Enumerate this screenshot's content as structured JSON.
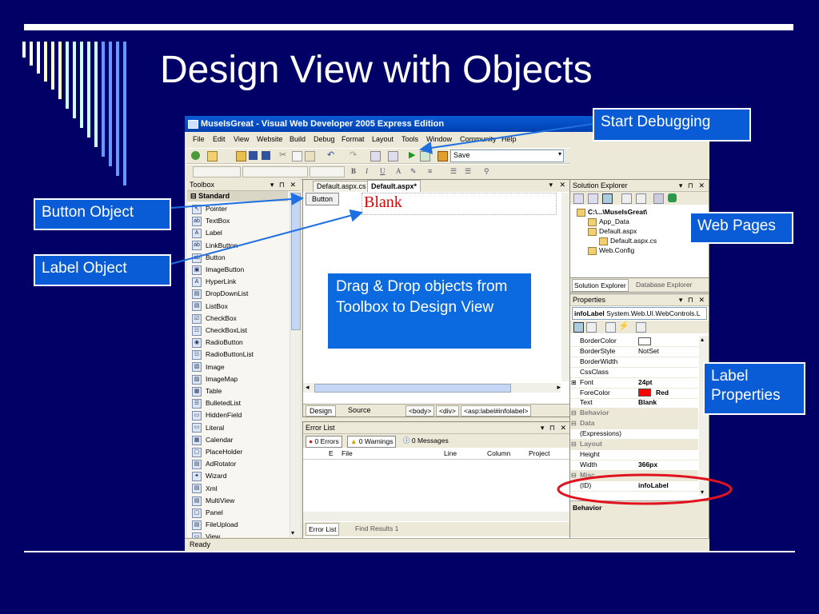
{
  "slide": {
    "title": "Design View with Objects"
  },
  "callouts": {
    "start_debugging": "Start Debugging",
    "button_object": "Button Object",
    "label_object": "Label Object",
    "web_pages": "Web Pages",
    "label_properties": "Label Properties",
    "drag_drop": "Drag & Drop objects from Toolbox to Design View"
  },
  "window": {
    "title": "MuseIsGreat - Visual Web Developer 2005 Express Edition",
    "menu": [
      "File",
      "Edit",
      "View",
      "Website",
      "Build",
      "Debug",
      "Format",
      "Layout",
      "Tools",
      "Window",
      "Community",
      "Help"
    ],
    "toolbar": {
      "save_label": "Save"
    },
    "status": "Ready"
  },
  "toolbox": {
    "title": "Toolbox",
    "pin": "▾ ⊓ ✕",
    "group": "Standard",
    "items": [
      {
        "label": "Pointer",
        "icon": "pointer-icon"
      },
      {
        "label": "TextBox",
        "icon": "textbox-icon"
      },
      {
        "label": "Label",
        "icon": "label-icon"
      },
      {
        "label": "LinkButton",
        "icon": "linkbutton-icon"
      },
      {
        "label": "Button",
        "icon": "button-icon"
      },
      {
        "label": "ImageButton",
        "icon": "imagebutton-icon"
      },
      {
        "label": "HyperLink",
        "icon": "hyperlink-icon"
      },
      {
        "label": "DropDownList",
        "icon": "dropdownlist-icon"
      },
      {
        "label": "ListBox",
        "icon": "listbox-icon"
      },
      {
        "label": "CheckBox",
        "icon": "checkbox-icon"
      },
      {
        "label": "CheckBoxList",
        "icon": "checkboxlist-icon"
      },
      {
        "label": "RadioButton",
        "icon": "radiobutton-icon"
      },
      {
        "label": "RadioButtonList",
        "icon": "radiobuttonlist-icon"
      },
      {
        "label": "Image",
        "icon": "image-icon"
      },
      {
        "label": "ImageMap",
        "icon": "imagemap-icon"
      },
      {
        "label": "Table",
        "icon": "table-icon"
      },
      {
        "label": "BulletedList",
        "icon": "bulletedlist-icon"
      },
      {
        "label": "HiddenField",
        "icon": "hiddenfield-icon"
      },
      {
        "label": "Literal",
        "icon": "literal-icon"
      },
      {
        "label": "Calendar",
        "icon": "calendar-icon"
      },
      {
        "label": "PlaceHolder",
        "icon": "placeholder-icon"
      },
      {
        "label": "AdRotator",
        "icon": "adrotator-icon"
      },
      {
        "label": "Wizard",
        "icon": "wizard-icon"
      },
      {
        "label": "Xml",
        "icon": "xml-icon"
      },
      {
        "label": "MultiView",
        "icon": "multiview-icon"
      },
      {
        "label": "Panel",
        "icon": "panel-icon"
      },
      {
        "label": "FileUpload",
        "icon": "fileupload-icon"
      },
      {
        "label": "View",
        "icon": "view-icon"
      }
    ]
  },
  "editor": {
    "tabs": [
      {
        "label": "Default.aspx.cs",
        "active": false
      },
      {
        "label": "Default.aspx*",
        "active": true
      }
    ],
    "button_text": "Button",
    "label_text": "Blank",
    "mode_tabs": [
      "Design",
      "Source"
    ],
    "breadcrumbs": [
      "<body>",
      "<div>",
      "<asp:label#infolabel>"
    ]
  },
  "error_list": {
    "title": "Error List",
    "filters": [
      "0 Errors",
      "0 Warnings",
      "0 Messages"
    ],
    "columns": [
      "",
      "File",
      "Line",
      "Column",
      "Project"
    ],
    "bottom_tabs": [
      "Error List",
      "Find Results 1"
    ]
  },
  "solution_explorer": {
    "title": "Solution Explorer",
    "tree": [
      {
        "label": "C:\\...\\MuseIsGreat\\",
        "level": 0,
        "bold": true
      },
      {
        "label": "App_Data",
        "level": 1
      },
      {
        "label": "Default.aspx",
        "level": 1
      },
      {
        "label": "Default.aspx.cs",
        "level": 2
      },
      {
        "label": "Web.Config",
        "level": 1
      }
    ],
    "tabs": [
      "Solution Explorer",
      "Database Explorer"
    ]
  },
  "properties": {
    "title": "Properties",
    "object_name": "infoLabel",
    "object_type": "System.Web.UI.WebControls.L",
    "rows": [
      {
        "k": "BorderColor",
        "v": "",
        "swatch": "#ffffff"
      },
      {
        "k": "BorderStyle",
        "v": "NotSet"
      },
      {
        "k": "BorderWidth",
        "v": ""
      },
      {
        "k": "CssClass",
        "v": ""
      },
      {
        "k": "Font",
        "v": "24pt",
        "bold": true,
        "expand": true
      },
      {
        "k": "ForeColor",
        "v": "Red",
        "bold": true,
        "swatch": "#ff0000"
      },
      {
        "k": "Text",
        "v": "Blank",
        "bold": true
      },
      {
        "k": "Behavior",
        "cat": true
      },
      {
        "k": "Data",
        "cat": true
      },
      {
        "k": "(Expressions)",
        "v": ""
      },
      {
        "k": "Layout",
        "cat": true
      },
      {
        "k": "Height",
        "v": ""
      },
      {
        "k": "Width",
        "v": "366px",
        "bold": true
      },
      {
        "k": "Misc",
        "cat": true
      },
      {
        "k": "(ID)",
        "v": "infoLabel",
        "bold": true
      }
    ],
    "footer": "Behavior"
  },
  "colors": {
    "slide_bg": "#000066",
    "callout_bg": "#0a5cd6",
    "highlight_ring": "#e0141e",
    "label_red": "#ff0000"
  }
}
